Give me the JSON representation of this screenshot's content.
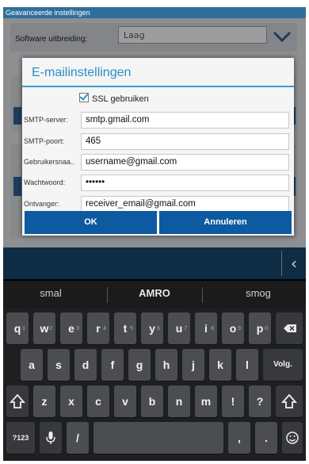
{
  "statusbar": {
    "title": "Geavanceerde instellingen"
  },
  "background": {
    "software_label": "Software uitbreiding:",
    "software_value": "Laag"
  },
  "dialog": {
    "title": "E-mailinstellingen",
    "ssl_label": "SSL gebruiken",
    "ssl_checked": true,
    "fields": [
      {
        "label": "SMTP-server:",
        "value": "smtp.gmail.com"
      },
      {
        "label": "SMTP-poort:",
        "value": "465"
      },
      {
        "label": "Gebruikersnaa..",
        "value": "username@gmail.com"
      },
      {
        "label": "Wachtwoord:",
        "value": "••••••"
      },
      {
        "label": "Ontvanger:",
        "value": "receiver_email@gmail.com"
      }
    ],
    "ok_label": "OK",
    "cancel_label": "Annuleren"
  },
  "keyboard": {
    "suggestions": [
      "smal",
      "AMRO",
      "smog"
    ],
    "row1": [
      {
        "k": "q",
        "n": "1"
      },
      {
        "k": "w",
        "n": "2"
      },
      {
        "k": "e",
        "n": "3"
      },
      {
        "k": "r",
        "n": "4"
      },
      {
        "k": "t",
        "n": "5"
      },
      {
        "k": "y",
        "n": "6"
      },
      {
        "k": "u",
        "n": "7"
      },
      {
        "k": "i",
        "n": "8"
      },
      {
        "k": "o",
        "n": "9"
      },
      {
        "k": "p",
        "n": "0"
      }
    ],
    "row2": [
      "a",
      "s",
      "d",
      "f",
      "g",
      "h",
      "j",
      "k",
      "l"
    ],
    "enter_label": "Volg.",
    "row3": [
      "z",
      "x",
      "c",
      "v",
      "b",
      "n",
      "m",
      "!",
      "?"
    ],
    "sym_label": "?123",
    "slash_label": "/",
    "comma_label": ",",
    "period_label": ".",
    "accent_color": "#0d5aa0"
  }
}
